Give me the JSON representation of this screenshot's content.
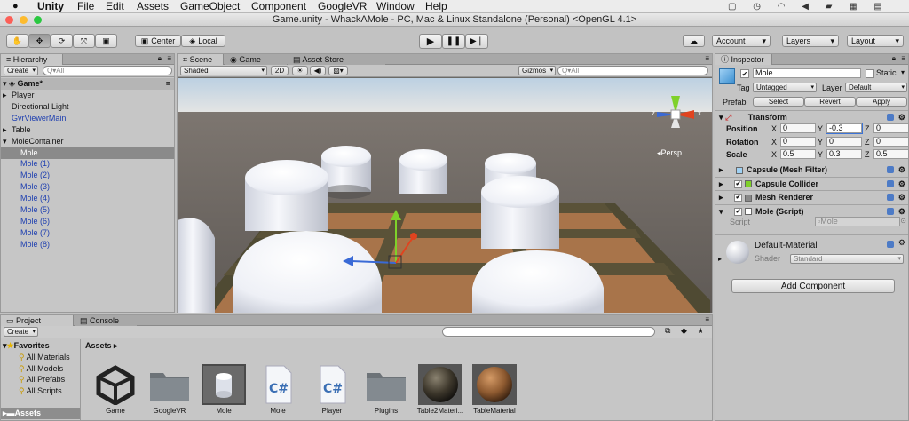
{
  "menubar": {
    "items": [
      "Unity",
      "File",
      "Edit",
      "Assets",
      "GameObject",
      "Component",
      "GoogleVR",
      "Window",
      "Help"
    ],
    "title": "Game.unity - WhackAMole - PC, Mac & Linux Standalone (Personal) <OpenGL 4.1>"
  },
  "toolbar": {
    "pivot": "Center",
    "space": "Local",
    "account": "Account",
    "layers": "Layers",
    "layout": "Layout"
  },
  "hierarchy": {
    "tab": "Hierarchy",
    "create": "Create",
    "search": "Q▾All",
    "scene": "Game*",
    "items": [
      {
        "label": "Player",
        "indent": 1,
        "arrow": true,
        "blue": false,
        "selected": false
      },
      {
        "label": "Directional Light",
        "indent": 1,
        "arrow": false,
        "blue": false,
        "selected": false
      },
      {
        "label": "GvrViewerMain",
        "indent": 1,
        "arrow": false,
        "blue": true,
        "selected": false
      },
      {
        "label": "Table",
        "indent": 1,
        "arrow": true,
        "blue": false,
        "selected": false
      },
      {
        "label": "MoleContainer",
        "indent": 1,
        "arrow": true,
        "open": true,
        "blue": false,
        "selected": false
      },
      {
        "label": "Mole",
        "indent": 2,
        "arrow": false,
        "blue": true,
        "selected": true
      },
      {
        "label": "Mole (1)",
        "indent": 2,
        "arrow": false,
        "blue": true,
        "selected": false
      },
      {
        "label": "Mole (2)",
        "indent": 2,
        "arrow": false,
        "blue": true,
        "selected": false
      },
      {
        "label": "Mole (3)",
        "indent": 2,
        "arrow": false,
        "blue": true,
        "selected": false
      },
      {
        "label": "Mole (4)",
        "indent": 2,
        "arrow": false,
        "blue": true,
        "selected": false
      },
      {
        "label": "Mole (5)",
        "indent": 2,
        "arrow": false,
        "blue": true,
        "selected": false
      },
      {
        "label": "Mole (6)",
        "indent": 2,
        "arrow": false,
        "blue": true,
        "selected": false
      },
      {
        "label": "Mole (7)",
        "indent": 2,
        "arrow": false,
        "blue": true,
        "selected": false
      },
      {
        "label": "Mole (8)",
        "indent": 2,
        "arrow": false,
        "blue": true,
        "selected": false
      }
    ]
  },
  "scene": {
    "tabs": [
      "Scene",
      "Game",
      "Asset Store"
    ],
    "shading": "Shaded",
    "mode2d": "2D",
    "gizmos": "Gizmos",
    "search": "Q▾All",
    "persp": "Persp",
    "axis_x": "x",
    "axis_z": "z"
  },
  "inspector": {
    "tab": "Inspector",
    "object_name": "Mole",
    "static_label": "Static",
    "tag_label": "Tag",
    "tag_value": "Untagged",
    "layer_label": "Layer",
    "layer_value": "Default",
    "prefab_label": "Prefab",
    "prefab_select": "Select",
    "prefab_revert": "Revert",
    "prefab_apply": "Apply",
    "transform": {
      "title": "Transform",
      "rows": [
        {
          "label": "Position",
          "x": "0",
          "y": "-0.3",
          "z": "0"
        },
        {
          "label": "Rotation",
          "x": "0",
          "y": "0",
          "z": "0"
        },
        {
          "label": "Scale",
          "x": "0.5",
          "y": "0.3",
          "z": "0.5"
        }
      ],
      "axis_x": "X",
      "axis_y": "Y",
      "axis_z": "Z"
    },
    "components": [
      "Capsule (Mesh Filter)",
      "Capsule Collider",
      "Mesh Renderer",
      "Mole (Script)"
    ],
    "script_label": "Script",
    "script_value": "Mole",
    "material_name": "Default-Material",
    "shader_label": "Shader",
    "shader_value": "Standard",
    "add_component": "Add Component"
  },
  "project": {
    "tabs": [
      "Project",
      "Console"
    ],
    "create": "Create",
    "favorites": "Favorites",
    "fav_items": [
      "All Materials",
      "All Models",
      "All Prefabs",
      "All Scripts"
    ],
    "assets_root": "Assets",
    "breadcrumb": "Assets ▸",
    "assets": [
      {
        "name": "Game",
        "kind": "unity"
      },
      {
        "name": "GoogleVR",
        "kind": "folder"
      },
      {
        "name": "Mole",
        "kind": "prefab"
      },
      {
        "name": "Mole",
        "kind": "cs"
      },
      {
        "name": "Player",
        "kind": "cs"
      },
      {
        "name": "Plugins",
        "kind": "folder"
      },
      {
        "name": "Table2Materi...",
        "kind": "material-dark"
      },
      {
        "name": "TableMaterial",
        "kind": "material-brown"
      }
    ]
  },
  "colors": {
    "selection": "#3b73d6",
    "blue_text": "#1e3fb0",
    "menubar": "#e9e9e9"
  }
}
